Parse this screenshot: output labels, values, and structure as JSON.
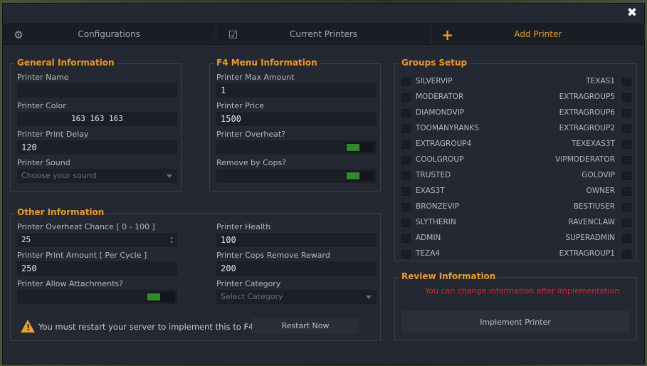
{
  "window": {
    "close_glyph": "✖"
  },
  "tabs": [
    {
      "label": "Configurations",
      "icon": "gear-icon",
      "glyph": "⚙"
    },
    {
      "label": "Current Printers",
      "icon": "list-check-icon",
      "glyph": "☑"
    },
    {
      "label": "Add Printer",
      "icon": "plus-icon",
      "glyph": "+"
    }
  ],
  "general": {
    "title": "General Information",
    "name_label": "Printer Name",
    "name_value": "",
    "color_label": "Printer Color",
    "color_value": "163 163 163",
    "delay_label": "Printer Print Delay",
    "delay_value": "120",
    "sound_label": "Printer Sound",
    "sound_placeholder": "Choose your sound"
  },
  "f4menu": {
    "title": "F4 Menu Information",
    "max_label": "Printer Max Amount",
    "max_value": "1",
    "price_label": "Printer Price",
    "price_value": "1500",
    "overheat_label": "Printer Overheat?",
    "cops_label": "Remove by Cops?"
  },
  "other": {
    "title": "Other Information",
    "overheat_chance_label": "Printer Overheat Chance [ 0 - 100 ]",
    "overheat_chance_value": "25",
    "print_amount_label": "Printer Print Amount [ Per Cycle ]",
    "print_amount_value": "250",
    "attachments_label": "Printer Allow Attachments?",
    "health_label": "Printer Health",
    "health_value": "100",
    "cops_reward_label": "Printer Cops Remove Reward",
    "cops_reward_value": "200",
    "category_label": "Printer Category",
    "category_placeholder": "Select Category"
  },
  "warning": {
    "text": "You must restart your server to implement this to F4.",
    "glyph": "!"
  },
  "restart_button": "Restart Now",
  "groups": {
    "title": "Groups Setup",
    "left": [
      "SILVERVIP",
      "MODERATOR",
      "DIAMONDVIP",
      "TOOMANYRANKS",
      "EXTRAGROUP4",
      "COOLGROUP",
      "TRUSTED",
      "EXAS3T",
      "BRONZEVIP",
      "SLYTHERIN",
      "ADMIN",
      "TEZA4"
    ],
    "right": [
      "TEXAS1",
      "EXTRAGROUP5",
      "EXTRAGROUP6",
      "EXTRAGROUP2",
      "TEXEXAS3T",
      "VIPMODERATOR",
      "GOLDVIP",
      "OWNER",
      "BESTIUSER",
      "RAVENCLAW",
      "SUPERADMIN",
      "EXTRAGROUP1"
    ]
  },
  "review": {
    "title": "Review Information",
    "note": "You can change information after implementation",
    "button": "Implement Printer"
  },
  "colors": {
    "accent": "#e89a2b",
    "toggle_on": "#2f8a2a",
    "warning_text": "#d8262a"
  }
}
